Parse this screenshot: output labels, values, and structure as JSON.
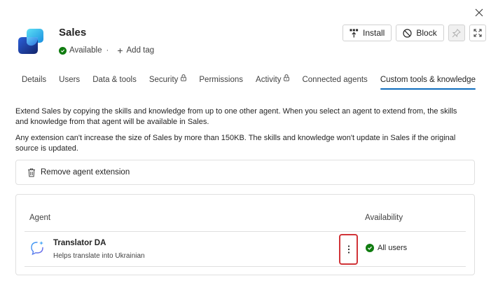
{
  "app": {
    "title": "Sales",
    "status": "Available",
    "add_tag": "Add tag"
  },
  "header_actions": {
    "install": "Install",
    "block": "Block"
  },
  "tabs": [
    {
      "label": "Details",
      "locked": false,
      "active": false
    },
    {
      "label": "Users",
      "locked": false,
      "active": false
    },
    {
      "label": "Data & tools",
      "locked": false,
      "active": false
    },
    {
      "label": "Security",
      "locked": true,
      "active": false
    },
    {
      "label": "Permissions",
      "locked": false,
      "active": false
    },
    {
      "label": "Activity",
      "locked": true,
      "active": false
    },
    {
      "label": "Connected agents",
      "locked": false,
      "active": false
    },
    {
      "label": "Custom tools & knowledge",
      "locked": false,
      "active": true
    }
  ],
  "description": {
    "p1": "Extend Sales by copying the skills and knowledge from up to one other agent. When you select an agent to extend from, the skills and knowledge from that agent will be available in Sales.",
    "p2": "Any extension can't increase the size of Sales by more than 150KB. The skills and knowledge won't update in Sales if the original source is updated."
  },
  "remove_extension": "Remove agent extension",
  "table": {
    "col_agent": "Agent",
    "col_availability": "Availability",
    "rows": [
      {
        "name": "Translator DA",
        "description": "Helps translate into Ukrainian",
        "availability": "All users"
      }
    ]
  },
  "colors": {
    "accent": "#0f6cbd",
    "success": "#107c10",
    "highlight": "#d13438"
  }
}
